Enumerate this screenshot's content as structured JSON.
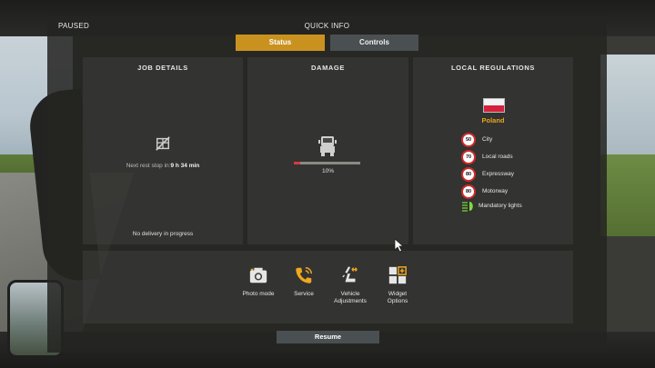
{
  "header": {
    "paused": "PAUSED",
    "title": "QUICK INFO"
  },
  "tabs": [
    {
      "label": "Status",
      "active": true
    },
    {
      "label": "Controls",
      "active": false
    }
  ],
  "job_details": {
    "title": "JOB DETAILS",
    "icon": "no-delivery-icon",
    "rest_label": "Next rest stop in:",
    "rest_value": "9 h 34 min",
    "status": "No delivery in progress"
  },
  "damage": {
    "title": "DAMAGE",
    "icon": "truck-icon",
    "percent_text": "10%",
    "fraction": 0.1,
    "bar_color": "#d93a3a"
  },
  "regulations": {
    "title": "LOCAL REGULATIONS",
    "country": "Poland",
    "flag_colors": [
      "#f4f4f4",
      "#d4213d"
    ],
    "limits": [
      {
        "value": "50",
        "label": "City"
      },
      {
        "value": "70",
        "label": "Local roads"
      },
      {
        "value": "80",
        "label": "Expressway"
      },
      {
        "value": "80",
        "label": "Motorway"
      }
    ],
    "lights_label": "Mandatory lights"
  },
  "actions": [
    {
      "label": "Photo mode",
      "icon": "camera-icon"
    },
    {
      "label": "Service",
      "icon": "phone-icon"
    },
    {
      "label": "Vehicle\nAdjustments",
      "icon": "seat-adjust-icon"
    },
    {
      "label": "Widget\nOptions",
      "icon": "widget-grid-icon"
    }
  ],
  "resume_label": "Resume",
  "colors": {
    "accent": "#c9921f",
    "inactive_tab": "#4a4f52",
    "country": "#e8a51c",
    "speed_ring": "#d02a2a"
  }
}
